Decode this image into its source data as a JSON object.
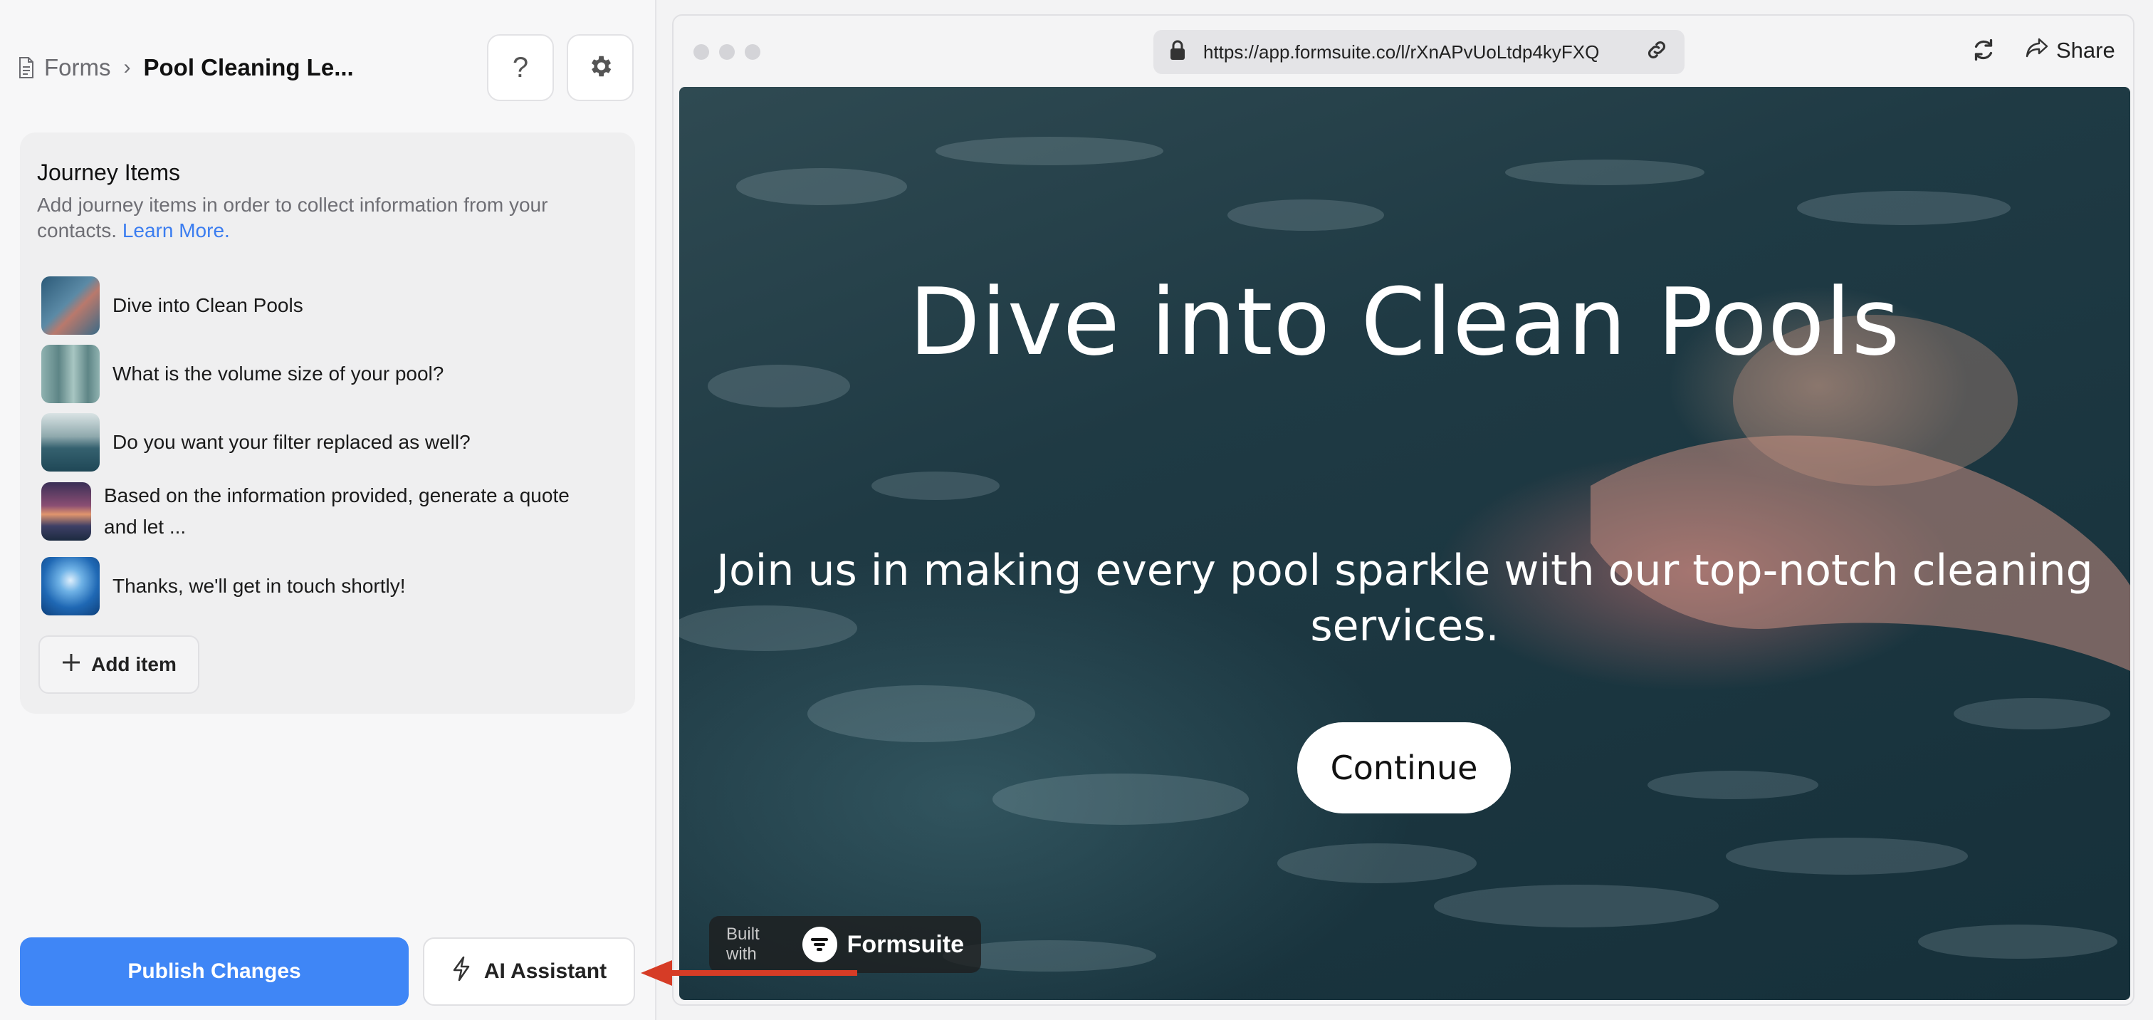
{
  "breadcrumb": {
    "root": "Forms",
    "separator": "›",
    "current": "Pool Cleaning Le..."
  },
  "header": {
    "help_label": "?"
  },
  "journey": {
    "title": "Journey Items",
    "description": "Add journey items in order to collect information from your contacts.",
    "learn_more": "Learn More.",
    "items": [
      {
        "label": "Dive into Clean Pools",
        "thumb_color": "#4a7a95"
      },
      {
        "label": "What is the volume size of your pool?",
        "thumb_color": "#6f9aa0"
      },
      {
        "label": "Do you want your filter replaced as well?",
        "thumb_color": "#3f6e86"
      },
      {
        "label": "Based on the information provided, generate a quote and let ...",
        "thumb_color": "#6a4f7a"
      },
      {
        "label": "Thanks, we'll get in touch shortly!",
        "thumb_color": "#2f6fb3"
      }
    ],
    "add_item": "Add item"
  },
  "footer": {
    "publish": "Publish Changes",
    "ai_assistant": "AI Assistant"
  },
  "browser": {
    "url": "https://app.formsuite.co/l/rXnAPvUoLtdp4kyFXQ",
    "share": "Share"
  },
  "preview": {
    "title": "Dive into Clean Pools",
    "subtitle": "Join us in making every pool sparkle with our top-notch cleaning services.",
    "continue": "Continue",
    "built_with": "Built with",
    "brand": "Formsuite"
  },
  "colors": {
    "accent": "#3f86f6",
    "annotation_arrow": "#d63c26"
  }
}
